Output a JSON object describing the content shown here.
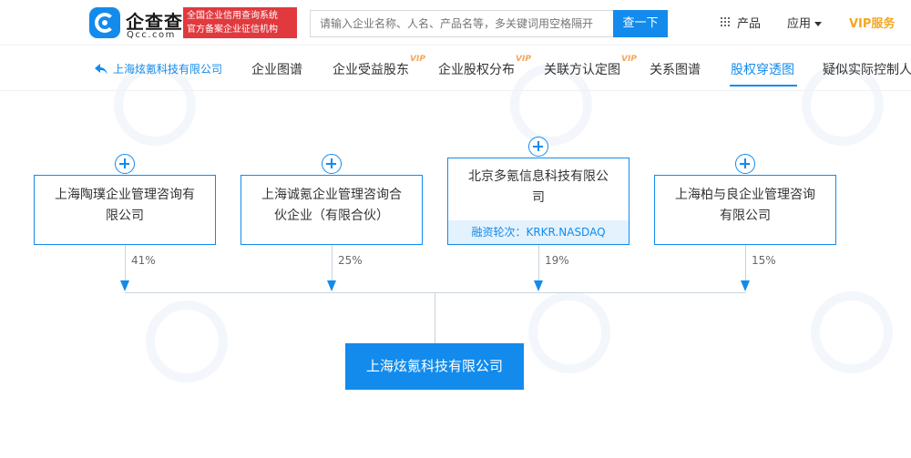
{
  "header": {
    "logo_cn": "企查查",
    "logo_en": "Qcc.com",
    "slogan_line1": "全国企业信用查询系统",
    "slogan_line2": "官方备案企业征信机构",
    "search_placeholder": "请输入企业名称、人名、产品名等，多关键词用空格隔开",
    "search_button": "查一下",
    "nav_product": "产品",
    "nav_app": "应用",
    "nav_vip": "VIP服务"
  },
  "tabs": {
    "back_label": "上海炫氪科技有限公司",
    "items": [
      {
        "label": "企业图谱",
        "vip": false
      },
      {
        "label": "企业受益股东",
        "vip": true
      },
      {
        "label": "企业股权分布",
        "vip": true
      },
      {
        "label": "关联方认定图",
        "vip": true
      },
      {
        "label": "关系图谱",
        "vip": false
      },
      {
        "label": "股权穿透图",
        "vip": false
      },
      {
        "label": "疑似实际控制人",
        "vip": false
      }
    ],
    "vip_mark": "VIP"
  },
  "diagram": {
    "shareholders": [
      {
        "name_line1": "上海陶璞企业管理咨询有",
        "name_line2": "限公司",
        "percent": "41%"
      },
      {
        "name_line1": "上海诚氪企业管理咨询合",
        "name_line2": "伙企业（有限合伙）",
        "percent": "25%"
      },
      {
        "name_line1": "北京多氪信息科技有限公",
        "name_line2": "司",
        "tag": "融资轮次：KRKR.NASDAQ",
        "percent": "19%"
      },
      {
        "name_line1": "上海柏与良企业管理咨询",
        "name_line2": "有限公司",
        "percent": "15%"
      }
    ],
    "target": "上海炫氪科技有限公司"
  },
  "colors": {
    "accent": "#128bed",
    "slogan_bg": "#e0393e",
    "vip": "#f4a623"
  }
}
